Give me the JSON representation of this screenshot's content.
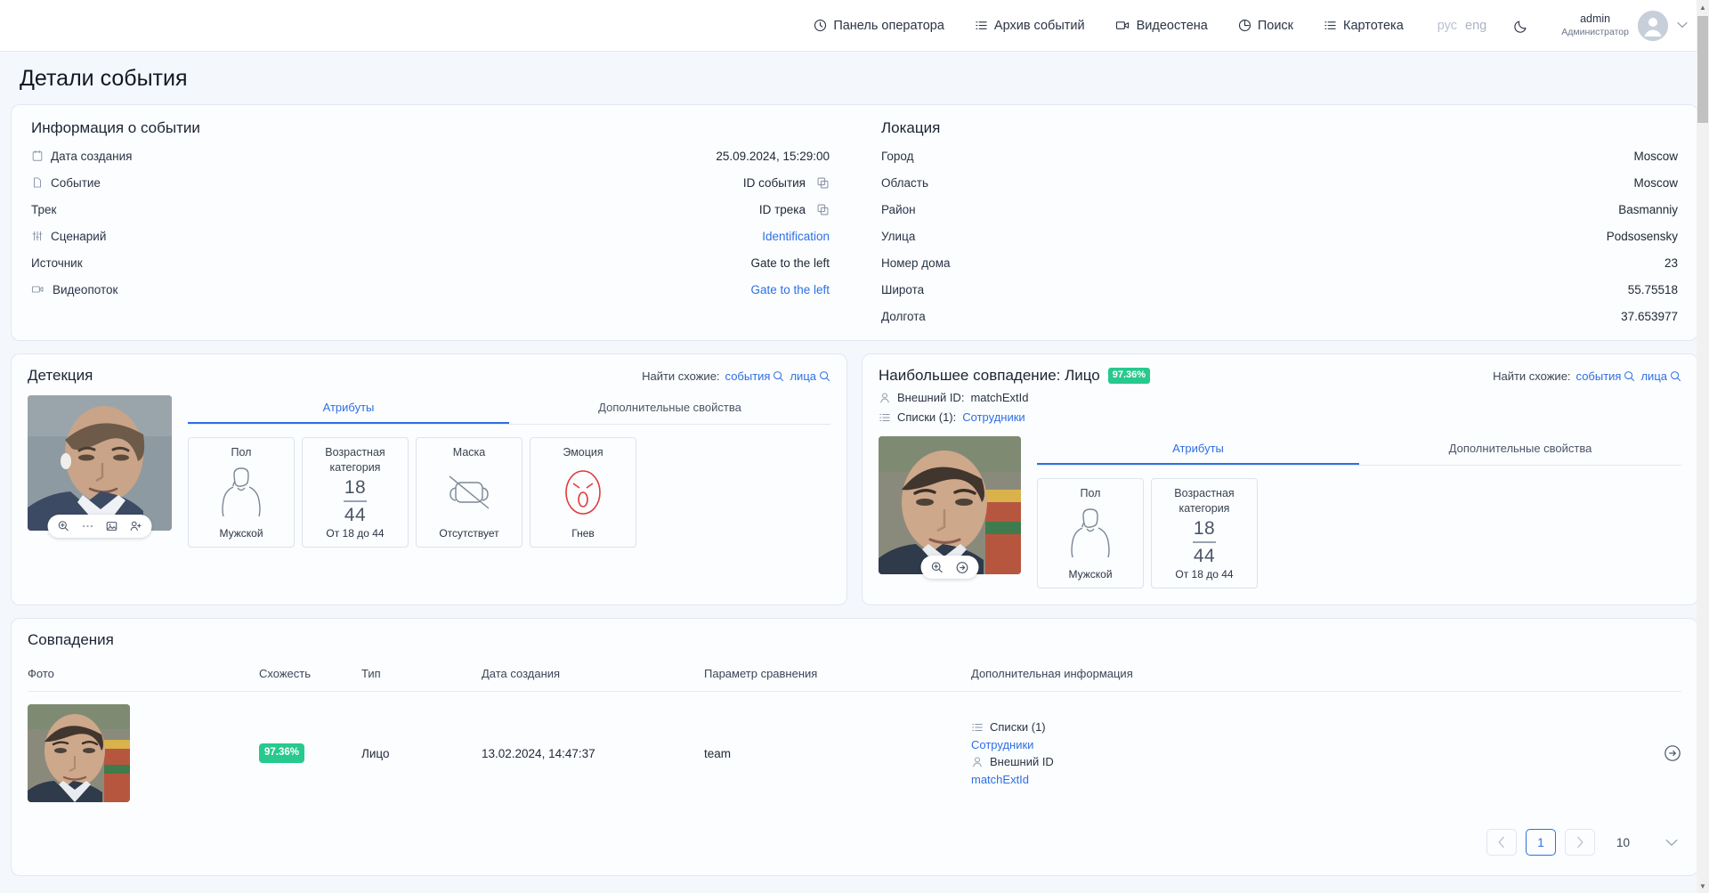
{
  "header": {
    "nav": [
      {
        "label": "Панель оператора",
        "icon": "clock-icon"
      },
      {
        "label": "Архив событий",
        "icon": "list-icon"
      },
      {
        "label": "Видеостена",
        "icon": "video-icon"
      },
      {
        "label": "Поиск",
        "icon": "search-circle-icon"
      },
      {
        "label": "Картотека",
        "icon": "list-icon"
      }
    ],
    "lang": {
      "ru": "рус",
      "en": "eng"
    },
    "theme_icon": "moon-icon",
    "user": {
      "name": "admin",
      "role": "Администратор"
    }
  },
  "page_title": "Детали события",
  "event_info": {
    "title": "Информация о событии",
    "rows": [
      {
        "label": "Дата создания",
        "icon": "calendar-icon",
        "value": "25.09.2024, 15:29:00",
        "link": false,
        "copy": false
      },
      {
        "label": "Событие",
        "icon": "file-icon",
        "value": "ID события",
        "link": false,
        "copy": true
      },
      {
        "label": "Трек",
        "icon": "none",
        "value": "ID трека",
        "link": false,
        "copy": true
      },
      {
        "label": "Сценарий",
        "icon": "sliders-icon",
        "value": "Identification",
        "link": true,
        "copy": false
      },
      {
        "label": "Источник",
        "icon": "none",
        "value": "Gate to the left",
        "link": false,
        "copy": false
      },
      {
        "label": "Видеопоток",
        "icon": "video-icon",
        "value": "Gate to the left",
        "link": true,
        "copy": false
      }
    ]
  },
  "location": {
    "title": "Локация",
    "rows": [
      {
        "label": "Город",
        "value": "Moscow"
      },
      {
        "label": "Область",
        "value": "Moscow"
      },
      {
        "label": "Район",
        "value": "Basmanniy"
      },
      {
        "label": "Улица",
        "value": "Podsosensky"
      },
      {
        "label": "Номер дома",
        "value": "23"
      },
      {
        "label": "Широта",
        "value": "55.75518"
      },
      {
        "label": "Долгота",
        "value": "37.653977"
      }
    ]
  },
  "detection": {
    "title": "Детекция",
    "find_similar": {
      "label": "Найти схожие:",
      "events": "события",
      "faces": "лица"
    },
    "tabs": [
      {
        "label": "Атрибуты",
        "active": true
      },
      {
        "label": "Дополнительные свойства",
        "active": false
      }
    ],
    "thumb_actions": [
      "zoom-in-icon",
      "more-icon",
      "image-icon",
      "add-person-icon"
    ],
    "attributes": [
      {
        "name": "Пол",
        "icon": "person-silhouette-icon",
        "value": "Мужской"
      },
      {
        "name": "Возрастная категория",
        "icon": "age-range-icon",
        "age_from": "18",
        "age_to": "44",
        "value": "От 18 до 44"
      },
      {
        "name": "Маска",
        "icon": "mask-crossed-icon",
        "value": "Отсутствует"
      },
      {
        "name": "Эмоция",
        "icon": "angry-face-icon",
        "value": "Гнев"
      }
    ]
  },
  "best_match": {
    "title": "Наибольшее совпадение: Лицо",
    "similarity": "97.36%",
    "external_id_label": "Внешний ID:",
    "external_id_value": "matchExtId",
    "lists_label": "Списки (1):",
    "lists_value": "Сотрудники",
    "find_similar": {
      "label": "Найти схожие:",
      "events": "события",
      "faces": "лица"
    },
    "tabs": [
      {
        "label": "Атрибуты",
        "active": true
      },
      {
        "label": "Дополнительные свойства",
        "active": false
      }
    ],
    "thumb_actions": [
      "zoom-in-icon",
      "arrow-right-icon"
    ],
    "attributes": [
      {
        "name": "Пол",
        "icon": "person-silhouette-icon",
        "value": "Мужской"
      },
      {
        "name": "Возрастная категория",
        "icon": "age-range-icon",
        "age_from": "18",
        "age_to": "44",
        "value": "От 18 до 44"
      }
    ]
  },
  "matches": {
    "title": "Совпадения",
    "columns": [
      "Фото",
      "Схожесть",
      "Тип",
      "Дата создания",
      "Параметр сравнения",
      "Дополнительная информация",
      ""
    ],
    "rows": [
      {
        "similarity": "97.36%",
        "type": "Лицо",
        "created": "13.02.2024, 14:47:37",
        "compare_param": "team",
        "lists_label": "Списки (1)",
        "lists_value": "Сотрудники",
        "external_id_label": "Внешний ID",
        "external_id_value": "matchExtId",
        "action_icon": "arrow-right-circle-icon"
      }
    ],
    "pagination": {
      "prev": "‹",
      "page": "1",
      "next": "›",
      "page_size": "10"
    }
  },
  "colors": {
    "accent": "#2f6fe4",
    "success": "#27c98e",
    "bg": "#f4f8fd",
    "card": "#fbfdff",
    "border": "#e1e8f1"
  }
}
